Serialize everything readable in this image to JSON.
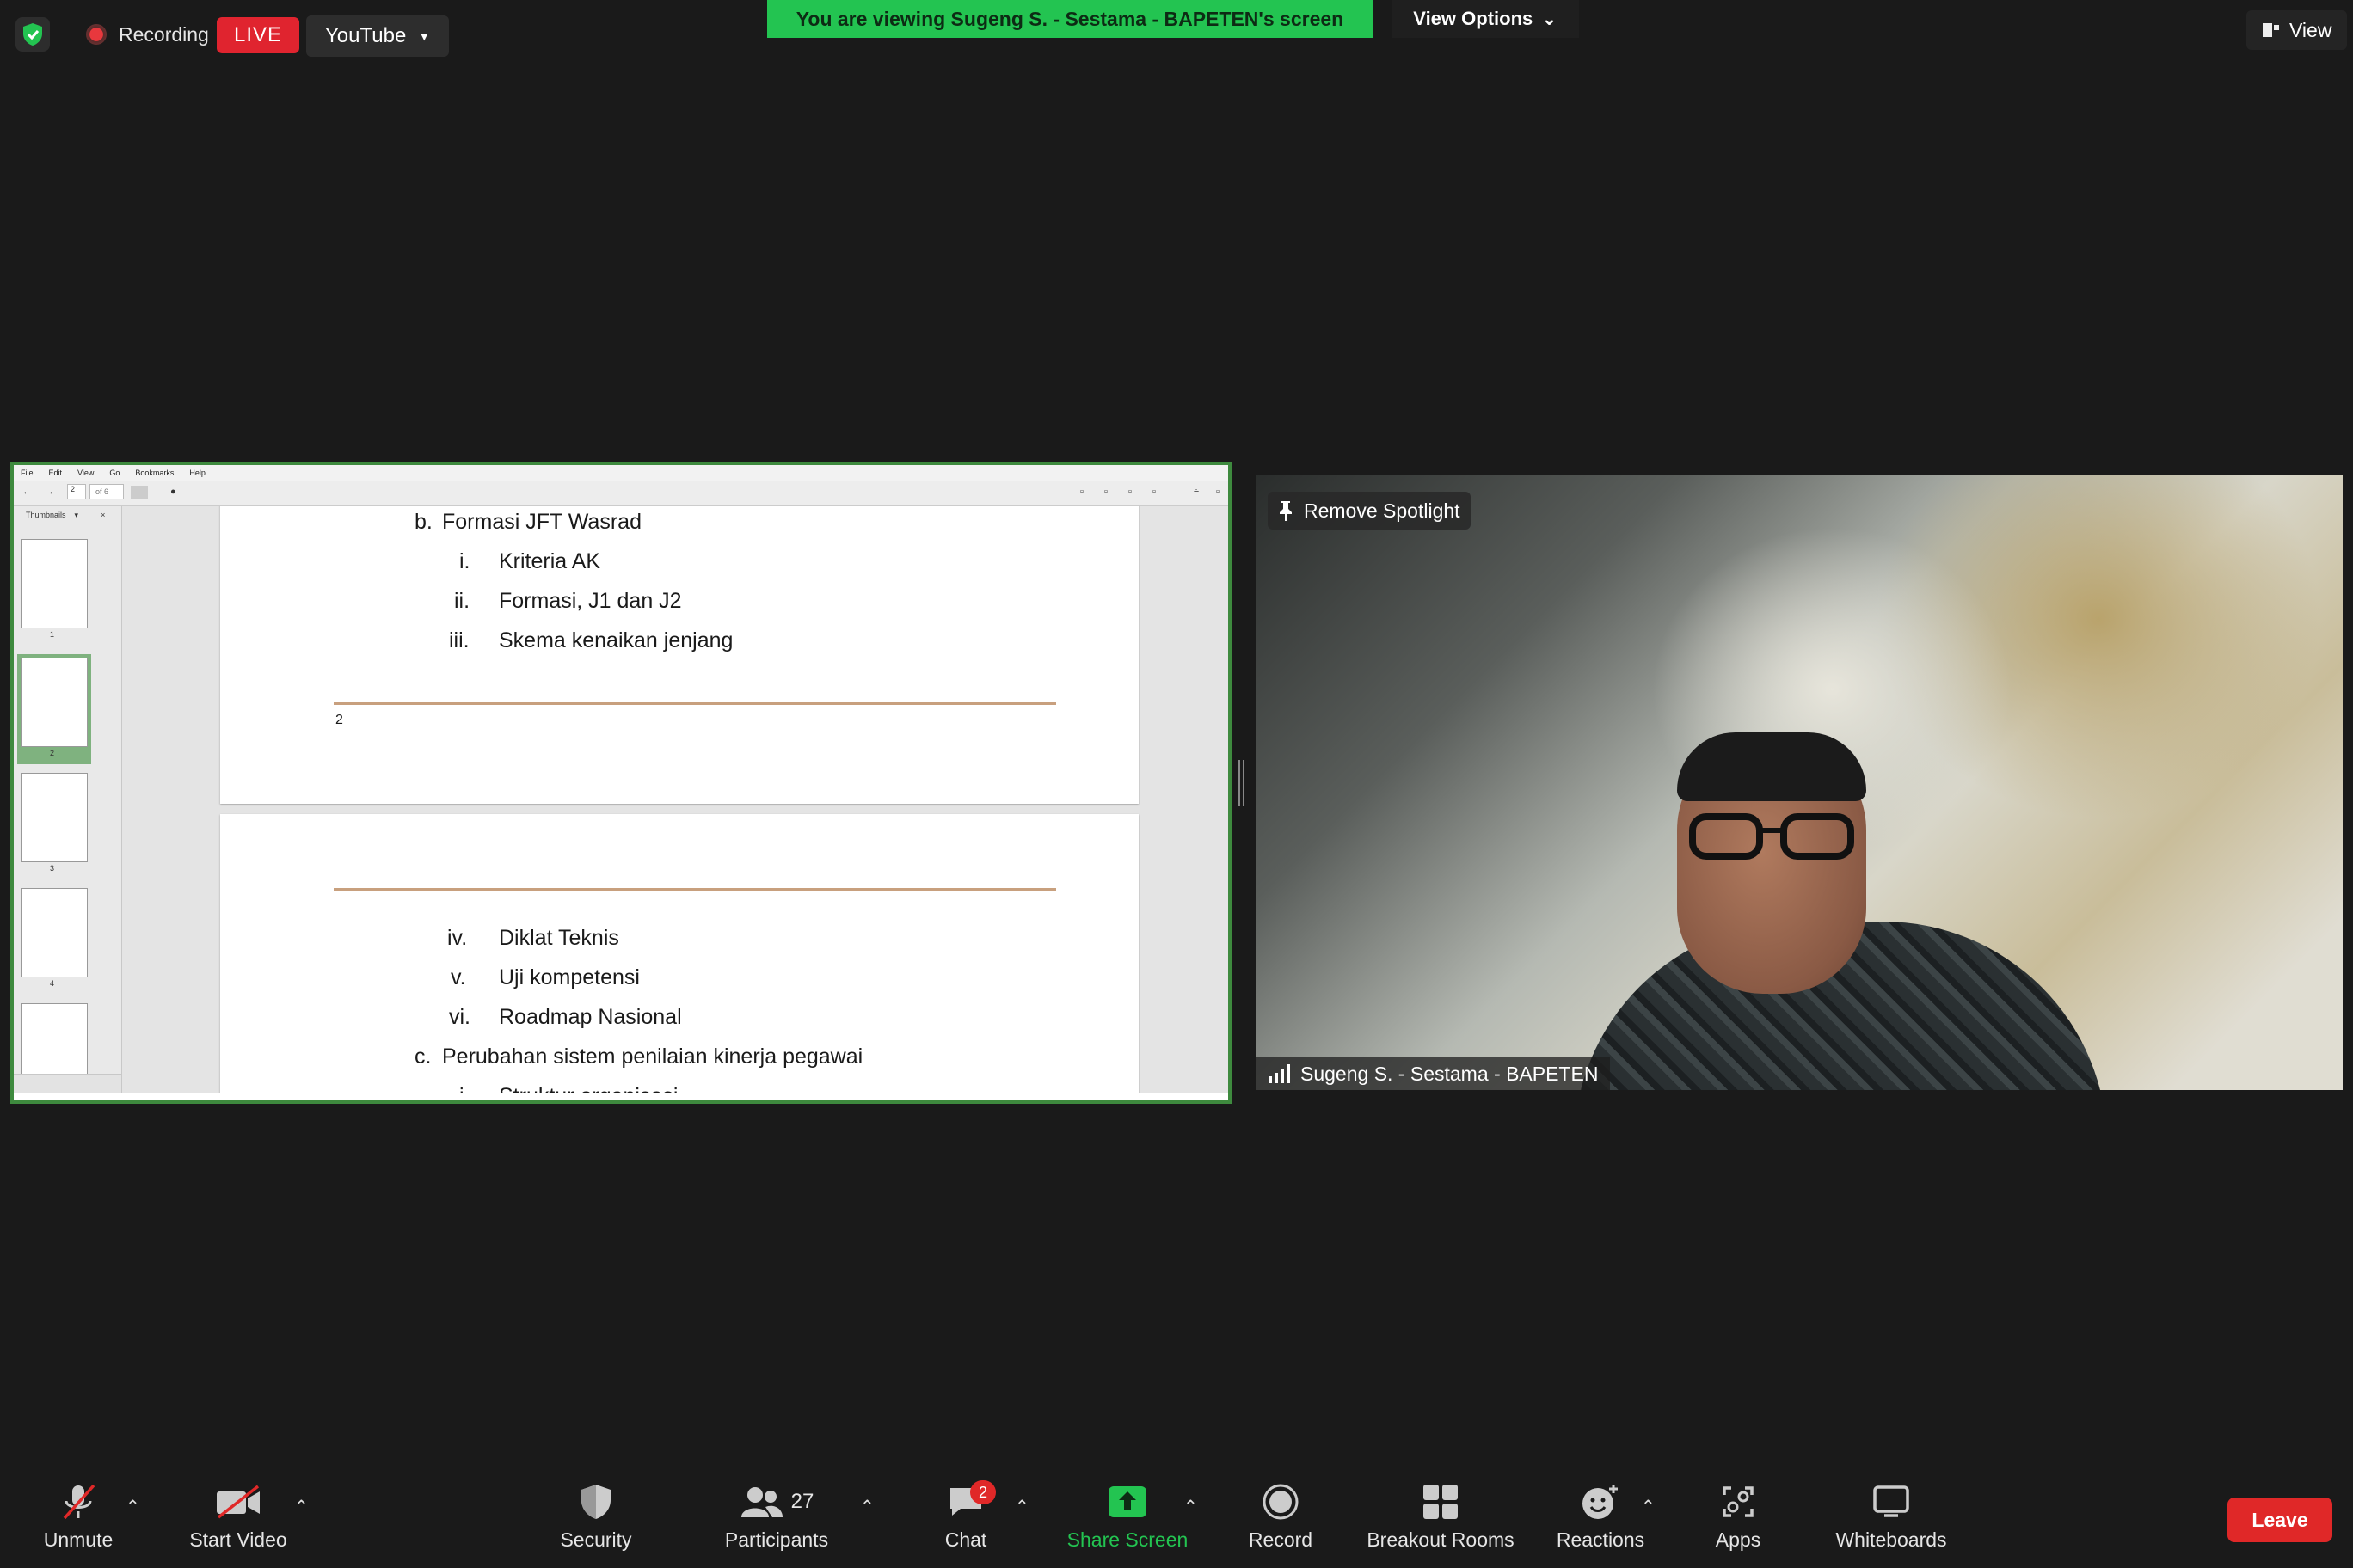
{
  "topbar": {
    "recording_label": "Recording",
    "live_label": "LIVE",
    "stream_target": "YouTube",
    "viewing_banner": "You are viewing Sugeng S. - Sestama - BAPETEN's screen",
    "view_options_label": "View Options",
    "view_label": "View"
  },
  "pdf_viewer": {
    "menu": [
      "File",
      "Edit",
      "View",
      "Go",
      "Bookmarks",
      "Help"
    ],
    "page_input": "2",
    "page_of": "of 6",
    "sidebar_title": "Thumbnails",
    "thumbnails": [
      "1",
      "2",
      "3",
      "4"
    ],
    "page1": {
      "lines": [
        {
          "marker": "b.",
          "text": "Formasi JFT Wasrad"
        },
        {
          "marker": "i.",
          "text": "Kriteria AK"
        },
        {
          "marker": "ii.",
          "text": "Formasi, J1 dan J2"
        },
        {
          "marker": "iii.",
          "text": "Skema kenaikan jenjang"
        }
      ],
      "page_number": "2"
    },
    "page2": {
      "lines": [
        {
          "marker": "iv.",
          "text": "Diklat Teknis"
        },
        {
          "marker": "v.",
          "text": "Uji kompetensi"
        },
        {
          "marker": "vi.",
          "text": "Roadmap Nasional"
        },
        {
          "marker": "c.",
          "text": "Perubahan sistem penilaian kinerja pegawai"
        },
        {
          "marker": "i.",
          "text": "Struktur organisasi"
        }
      ]
    }
  },
  "video": {
    "remove_spotlight_label": "Remove Spotlight",
    "participant_name": "Sugeng S. - Sestama - BAPETEN"
  },
  "toolbar": {
    "unmute": "Unmute",
    "start_video": "Start Video",
    "security": "Security",
    "participants": "Participants",
    "participants_count": "27",
    "chat": "Chat",
    "chat_badge": "2",
    "share_screen": "Share Screen",
    "record": "Record",
    "breakout_rooms": "Breakout Rooms",
    "reactions": "Reactions",
    "apps": "Apps",
    "whiteboards": "Whiteboards",
    "leave": "Leave"
  },
  "colors": {
    "share_banner": "#23c451",
    "live_badge": "#e0242f",
    "leave_button": "#e02828",
    "share_border": "#3e8a3e",
    "share_screen_icon": "#23c451"
  }
}
